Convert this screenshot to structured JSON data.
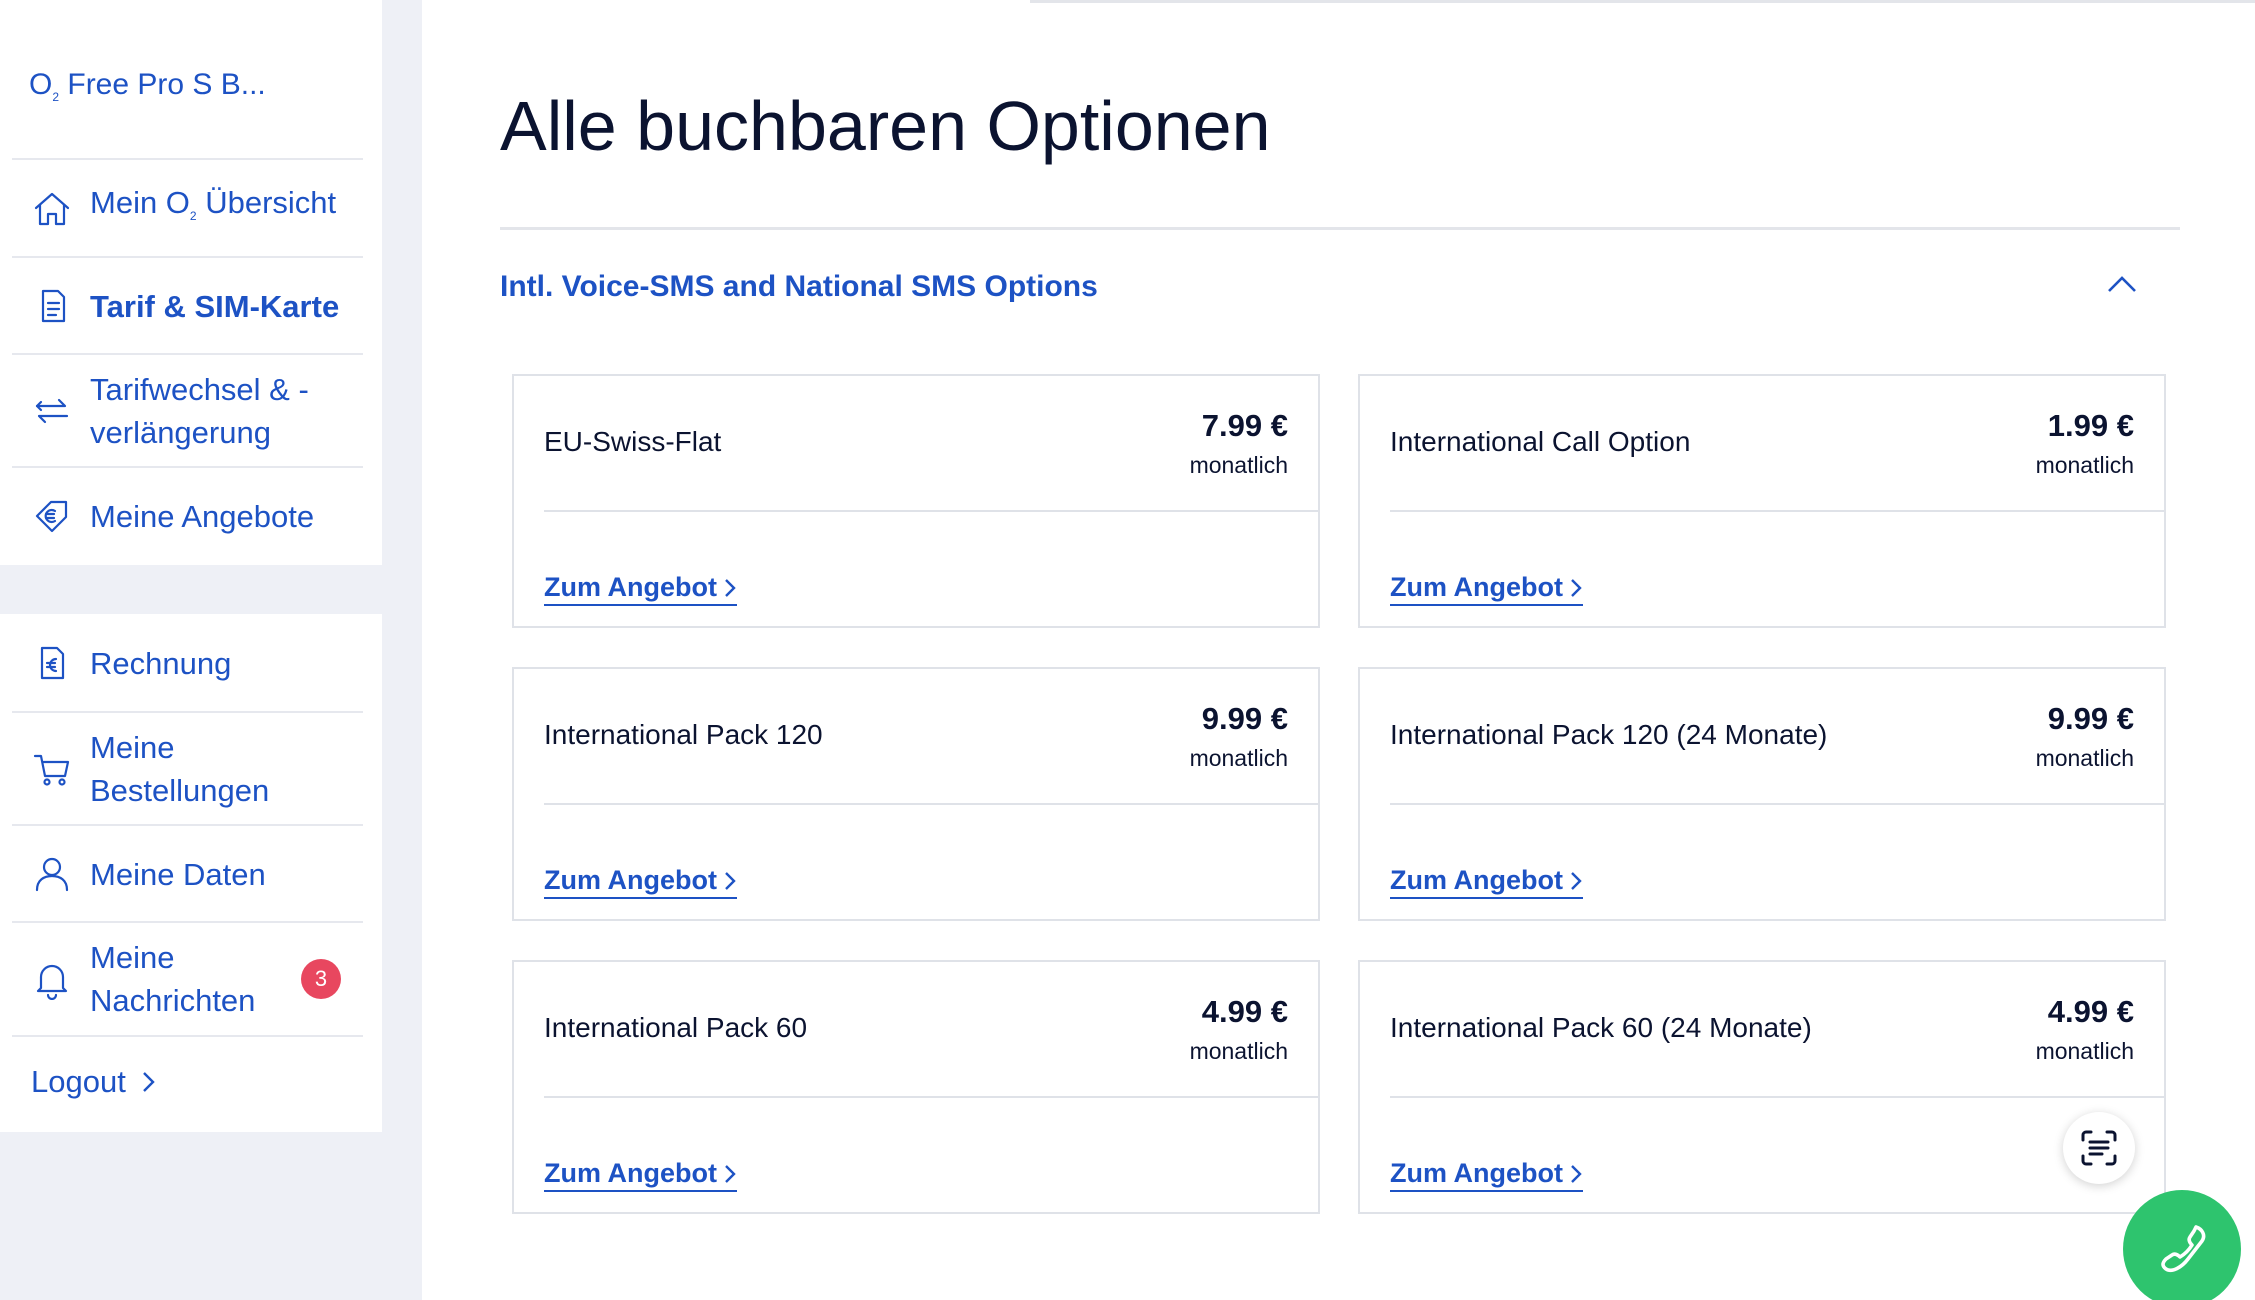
{
  "sidebar": {
    "tarif_title_pre": "O",
    "tarif_title_sub": "2",
    "tarif_title_post": " Free Pro S B...",
    "items": [
      {
        "label_pre": "Mein O",
        "label_sub": "2",
        "label_post": " Übersicht",
        "icon": "home-icon",
        "active": false
      },
      {
        "label": "Tarif & SIM-Karte",
        "icon": "document-icon",
        "active": true
      },
      {
        "label_line1": "Tarifwechsel & -",
        "label_line2": "verlängerung",
        "icon": "swap-arrows-icon",
        "active": false
      },
      {
        "label": "Meine Angebote",
        "icon": "euro-tag-icon",
        "active": false
      },
      {
        "label": "Rechnung",
        "icon": "euro-invoice-icon",
        "active": false
      },
      {
        "label_line1": "Meine",
        "label_line2": "Bestellungen",
        "icon": "cart-icon",
        "active": false
      },
      {
        "label": "Meine Daten",
        "icon": "user-icon",
        "active": false
      },
      {
        "label_line1": "Meine",
        "label_line2": "Nachrichten",
        "icon": "bell-icon",
        "active": false,
        "badge": "3"
      }
    ],
    "logout_label": "Logout"
  },
  "main": {
    "title": "Alle buchbaren Optionen",
    "section_title": "Intl. Voice-SMS and National SMS Options",
    "link_label": "Zum Angebot",
    "offers": [
      {
        "name": "EU-Swiss-Flat",
        "price": "7.99 €",
        "period": "monatlich"
      },
      {
        "name": "International Call Option",
        "price": "1.99 €",
        "period": "monatlich"
      },
      {
        "name": "International Pack 120",
        "price": "9.99 €",
        "period": "monatlich"
      },
      {
        "name": "International Pack 120 (24 Monate)",
        "price": "9.99 €",
        "period": "monatlich"
      },
      {
        "name": "International Pack 60",
        "price": "4.99 €",
        "period": "monatlich"
      },
      {
        "name": "International Pack 60 (24 Monate)",
        "price": "4.99 €",
        "period": "monatlich"
      }
    ]
  },
  "colors": {
    "accent": "#1d52c4",
    "text": "#0b1330",
    "badge": "#e8475f",
    "call_button": "#2ec46e",
    "sidebar_bg": "#eef0f6"
  }
}
